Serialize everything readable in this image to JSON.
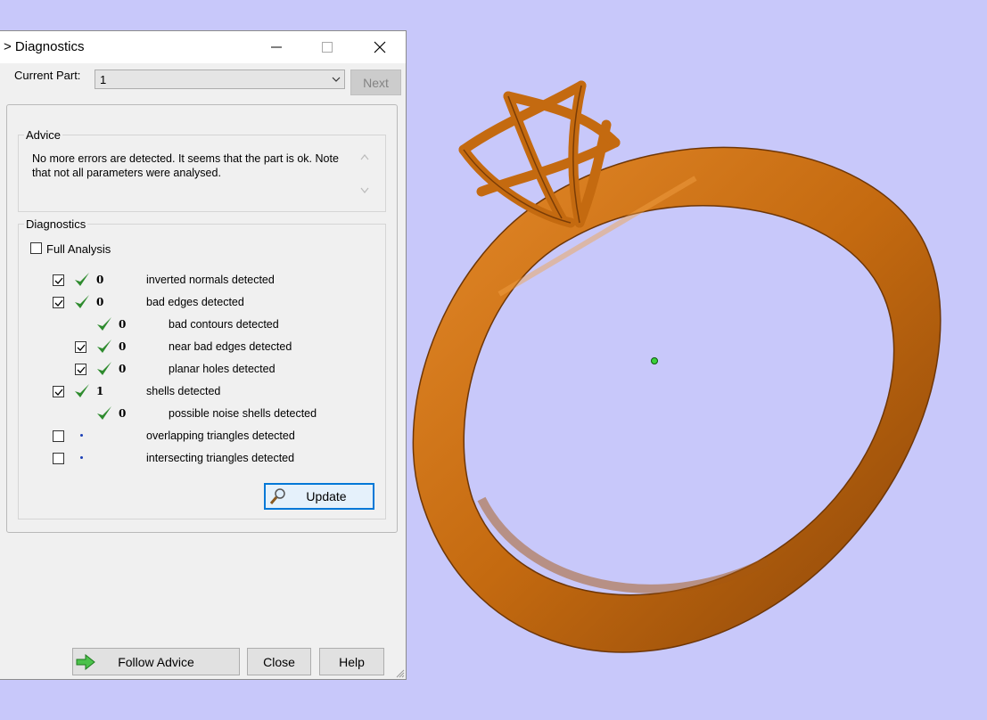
{
  "window": {
    "title": "> Diagnostics"
  },
  "current_part": {
    "label": "Current Part:",
    "value": "1",
    "next_label": "Next"
  },
  "advice": {
    "group_label": "Advice",
    "text": "No more errors are detected. It seems that the part is ok. Note that not all parameters were analysed."
  },
  "diagnostics": {
    "group_label": "Diagnostics",
    "full_analysis_label": "Full Analysis",
    "rows": [
      {
        "checked": true,
        "status": "ok",
        "count": "0",
        "label": "inverted normals detected"
      },
      {
        "checked": true,
        "status": "ok",
        "count": "0",
        "label": "bad edges detected"
      },
      {
        "checked": null,
        "status": "ok",
        "count": "0",
        "label": "bad contours detected"
      },
      {
        "checked": true,
        "status": "ok",
        "count": "0",
        "label": "near bad edges detected"
      },
      {
        "checked": true,
        "status": "ok",
        "count": "0",
        "label": "planar holes detected"
      },
      {
        "checked": true,
        "status": "ok",
        "count": "1",
        "label": "shells detected"
      },
      {
        "checked": null,
        "status": "ok",
        "count": "0",
        "label": "possible noise shells detected"
      },
      {
        "checked": false,
        "status": "pending",
        "count": "",
        "label": "overlapping triangles detected"
      },
      {
        "checked": false,
        "status": "pending",
        "count": "",
        "label": "intersecting triangles detected"
      }
    ],
    "update_label": "Update"
  },
  "footer": {
    "follow_label": "Follow Advice",
    "close_label": "Close",
    "help_label": "Help"
  },
  "colors": {
    "viewport_bg": "#c8c8fa",
    "ring": "#c46a10",
    "check_green": "#2e8b2e",
    "focus_blue": "#0078d7"
  }
}
